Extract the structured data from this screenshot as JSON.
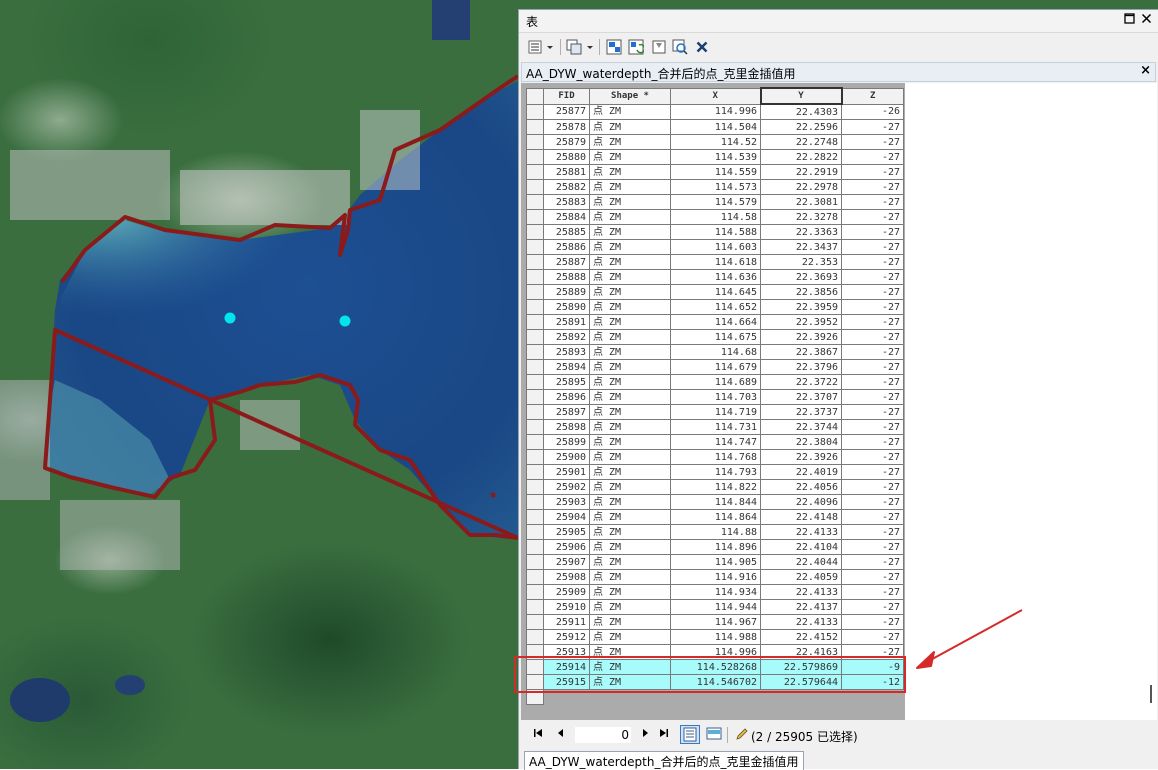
{
  "window": {
    "title": "表",
    "maximize_icon": "maximize-icon",
    "close_icon": "close-icon"
  },
  "toolbar": {
    "icons": [
      "table-options-icon",
      "related-tables-icon",
      "select-by-attributes-icon",
      "switch-selection-icon",
      "clear-selection-icon",
      "zoom-to-selected-icon",
      "delete-selected-icon"
    ]
  },
  "table_tab": {
    "name": "AA_DYW_waterdepth_合并后的点_克里金插值用"
  },
  "columns": [
    "FID",
    "Shape *",
    "X",
    "Y",
    "Z"
  ],
  "rows": [
    [
      "25877",
      "点 ZM",
      "114.996",
      "22.4303",
      "-26"
    ],
    [
      "25878",
      "点 ZM",
      "114.504",
      "22.2596",
      "-27"
    ],
    [
      "25879",
      "点 ZM",
      "114.52",
      "22.2748",
      "-27"
    ],
    [
      "25880",
      "点 ZM",
      "114.539",
      "22.2822",
      "-27"
    ],
    [
      "25881",
      "点 ZM",
      "114.559",
      "22.2919",
      "-27"
    ],
    [
      "25882",
      "点 ZM",
      "114.573",
      "22.2978",
      "-27"
    ],
    [
      "25883",
      "点 ZM",
      "114.579",
      "22.3081",
      "-27"
    ],
    [
      "25884",
      "点 ZM",
      "114.58",
      "22.3278",
      "-27"
    ],
    [
      "25885",
      "点 ZM",
      "114.588",
      "22.3363",
      "-27"
    ],
    [
      "25886",
      "点 ZM",
      "114.603",
      "22.3437",
      "-27"
    ],
    [
      "25887",
      "点 ZM",
      "114.618",
      "22.353",
      "-27"
    ],
    [
      "25888",
      "点 ZM",
      "114.636",
      "22.3693",
      "-27"
    ],
    [
      "25889",
      "点 ZM",
      "114.645",
      "22.3856",
      "-27"
    ],
    [
      "25890",
      "点 ZM",
      "114.652",
      "22.3959",
      "-27"
    ],
    [
      "25891",
      "点 ZM",
      "114.664",
      "22.3952",
      "-27"
    ],
    [
      "25892",
      "点 ZM",
      "114.675",
      "22.3926",
      "-27"
    ],
    [
      "25893",
      "点 ZM",
      "114.68",
      "22.3867",
      "-27"
    ],
    [
      "25894",
      "点 ZM",
      "114.679",
      "22.3796",
      "-27"
    ],
    [
      "25895",
      "点 ZM",
      "114.689",
      "22.3722",
      "-27"
    ],
    [
      "25896",
      "点 ZM",
      "114.703",
      "22.3707",
      "-27"
    ],
    [
      "25897",
      "点 ZM",
      "114.719",
      "22.3737",
      "-27"
    ],
    [
      "25898",
      "点 ZM",
      "114.731",
      "22.3744",
      "-27"
    ],
    [
      "25899",
      "点 ZM",
      "114.747",
      "22.3804",
      "-27"
    ],
    [
      "25900",
      "点 ZM",
      "114.768",
      "22.3926",
      "-27"
    ],
    [
      "25901",
      "点 ZM",
      "114.793",
      "22.4019",
      "-27"
    ],
    [
      "25902",
      "点 ZM",
      "114.822",
      "22.4056",
      "-27"
    ],
    [
      "25903",
      "点 ZM",
      "114.844",
      "22.4096",
      "-27"
    ],
    [
      "25904",
      "点 ZM",
      "114.864",
      "22.4148",
      "-27"
    ],
    [
      "25905",
      "点 ZM",
      "114.88",
      "22.4133",
      "-27"
    ],
    [
      "25906",
      "点 ZM",
      "114.896",
      "22.4104",
      "-27"
    ],
    [
      "25907",
      "点 ZM",
      "114.905",
      "22.4044",
      "-27"
    ],
    [
      "25908",
      "点 ZM",
      "114.916",
      "22.4059",
      "-27"
    ],
    [
      "25909",
      "点 ZM",
      "114.934",
      "22.4133",
      "-27"
    ],
    [
      "25910",
      "点 ZM",
      "114.944",
      "22.4137",
      "-27"
    ],
    [
      "25911",
      "点 ZM",
      "114.967",
      "22.4133",
      "-27"
    ],
    [
      "25912",
      "点 ZM",
      "114.988",
      "22.4152",
      "-27"
    ],
    [
      "25913",
      "点 ZM",
      "114.996",
      "22.4163",
      "-27"
    ],
    [
      "25914",
      "点 ZM",
      "114.528268",
      "22.579869",
      "-9"
    ],
    [
      "25915",
      "点 ZM",
      "114.546702",
      "22.579644",
      "-12"
    ]
  ],
  "selected_rows": [
    "25914",
    "25915"
  ],
  "nav": {
    "record_value": "0",
    "status": "(2 / 25905 已选择)"
  },
  "bottom_tab": {
    "label": "AA_DYW_waterdepth_合并后的点_克里金插值用"
  },
  "colors": {
    "selection": "#a8fbfb",
    "boundary": "#8b1a1a",
    "highlight": "#d42a2a",
    "point": "#00e5ee"
  }
}
